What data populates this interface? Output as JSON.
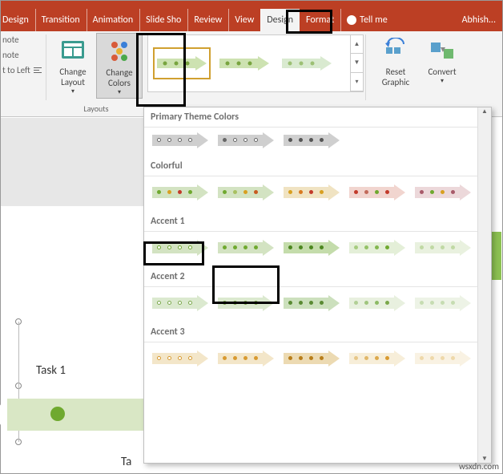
{
  "tabs": {
    "design": "Design",
    "transition": "Transition",
    "animations": "Animation",
    "slideshow": "Slide Sho",
    "review": "Review",
    "view": "View",
    "design_tool": "Design",
    "format": "Format",
    "tellme": "Tell me",
    "user": "Abhish..."
  },
  "ribbon_stub": {
    "line1": "note",
    "line2": "note",
    "line3": "t to Left"
  },
  "ribbon": {
    "change_layout": "Change Layout",
    "change_colors": "Change Colors",
    "layouts_label": "Layouts",
    "reset_graphic": "Reset Graphic",
    "convert": "Convert"
  },
  "dropdown": {
    "primary": "Primary Theme Colors",
    "colorful": "Colorful",
    "accent1": "Accent 1",
    "accent2": "Accent 2",
    "accent3": "Accent 3"
  },
  "slide": {
    "task1": "Task  1",
    "task2": "Ta"
  },
  "watermark": "wsxdn.com"
}
